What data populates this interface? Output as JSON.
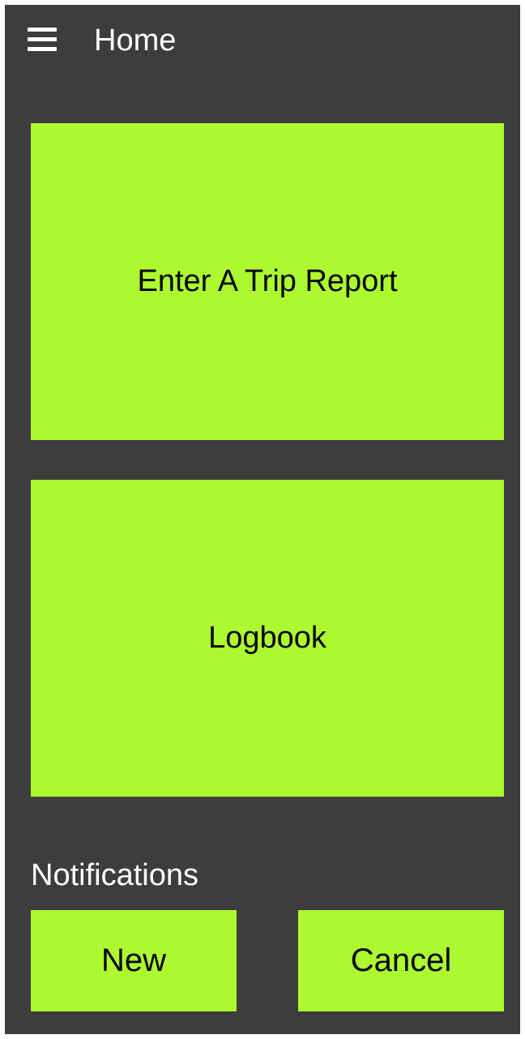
{
  "app_bar": {
    "menu_icon": "hamburger-menu-icon",
    "title": "Home"
  },
  "tiles": {
    "trip_report_label": "Enter A Trip Report",
    "logbook_label": "Logbook"
  },
  "notifications": {
    "section_label": "Notifications",
    "new_label": "New",
    "cancel_label": "Cancel"
  },
  "colors": {
    "background": "#3d3d3d",
    "accent": "#adf930",
    "app_bar_text": "#ffffff",
    "tile_text": "#000000"
  }
}
